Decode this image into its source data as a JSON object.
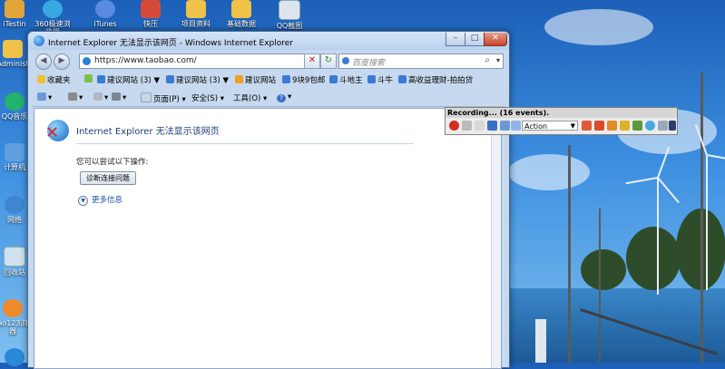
{
  "desktop": {
    "icons": [
      {
        "label": "iTestin"
      },
      {
        "label": "360极速浏览器"
      },
      {
        "label": "iTunes"
      },
      {
        "label": "快压"
      },
      {
        "label": "项目资料"
      },
      {
        "label": "基础数据"
      },
      {
        "label": "QQ截图20160405..."
      },
      {
        "label": "Administ"
      },
      {
        "label": "QQ音乐"
      },
      {
        "label": "计算机"
      },
      {
        "label": "网络"
      },
      {
        "label": "回收站"
      },
      {
        "label": "ao123浏器"
      }
    ]
  },
  "window": {
    "title": "Internet Explorer 无法显示该网页 - Windows Internet Explorer",
    "controls": {
      "minimize": "–",
      "maximize": "□",
      "close": "✕"
    }
  },
  "nav": {
    "back": "◀",
    "forward": "▶",
    "url": "https://www.taobao.com/",
    "refresh": "↻",
    "stop": "✕",
    "search_placeholder": "百度搜索",
    "search_icon": "⌕"
  },
  "favorites": {
    "label": "收藏夹",
    "items": [
      {
        "label": "建议网站 (3) ▼"
      },
      {
        "label": "建议网站 (3) ▼"
      },
      {
        "label": "建议网站"
      },
      {
        "label": "9块9包邮"
      },
      {
        "label": "斗地主"
      },
      {
        "label": "斗牛"
      },
      {
        "label": "高收益理财-拍拍贷"
      }
    ]
  },
  "commands": {
    "page": "页面(P) ▾",
    "safety": "安全(S) ▾",
    "tools": "工具(O) ▾",
    "help": "?"
  },
  "error_page": {
    "title": "Internet Explorer 无法显示该网页",
    "hint": "您可以尝试以下操作:",
    "diagnose_button": "诊断连接问题",
    "more_info": "更多信息"
  },
  "recorder": {
    "title": "Recording... (16 events).",
    "action_value": "Action"
  },
  "colors": {
    "link": "#1d4fa0",
    "error_x": "#dd2222",
    "record": "#d42b1e"
  }
}
